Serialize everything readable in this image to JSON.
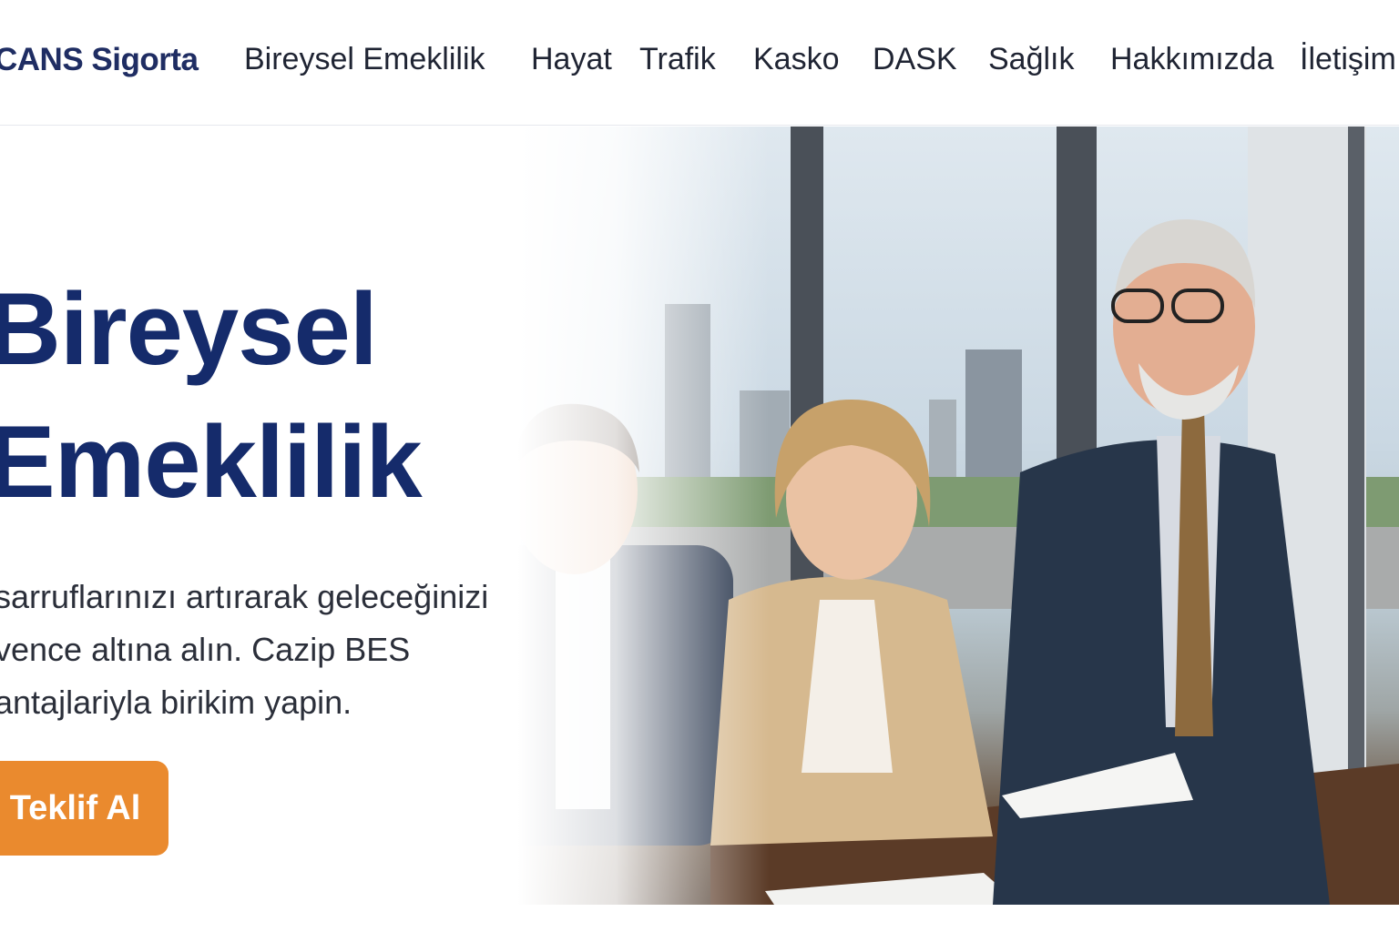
{
  "brand": {
    "name": "CANS Sigorta"
  },
  "nav": {
    "items": [
      {
        "label": "Bireysel Emeklilik"
      },
      {
        "label": "Hayat"
      },
      {
        "label": "Trafik"
      },
      {
        "label": "Kasko"
      },
      {
        "label": "DASK"
      },
      {
        "label": "Sağlık"
      },
      {
        "label": "Hakkımızda"
      },
      {
        "label": "İletişim"
      }
    ]
  },
  "hero": {
    "title_lines": [
      "Bireysel",
      "Emeklilik"
    ],
    "description_lines": [
      "sarruflarınızı artırarak geleceğinizi",
      "vence altına alın. Cazip BES",
      "antajlariyla birikim yapin."
    ],
    "cta_label": "Teklif Al"
  },
  "colors": {
    "brand_navy": "#152b6b",
    "cta_orange": "#ea8a2e",
    "text_dark": "#1f2433"
  }
}
